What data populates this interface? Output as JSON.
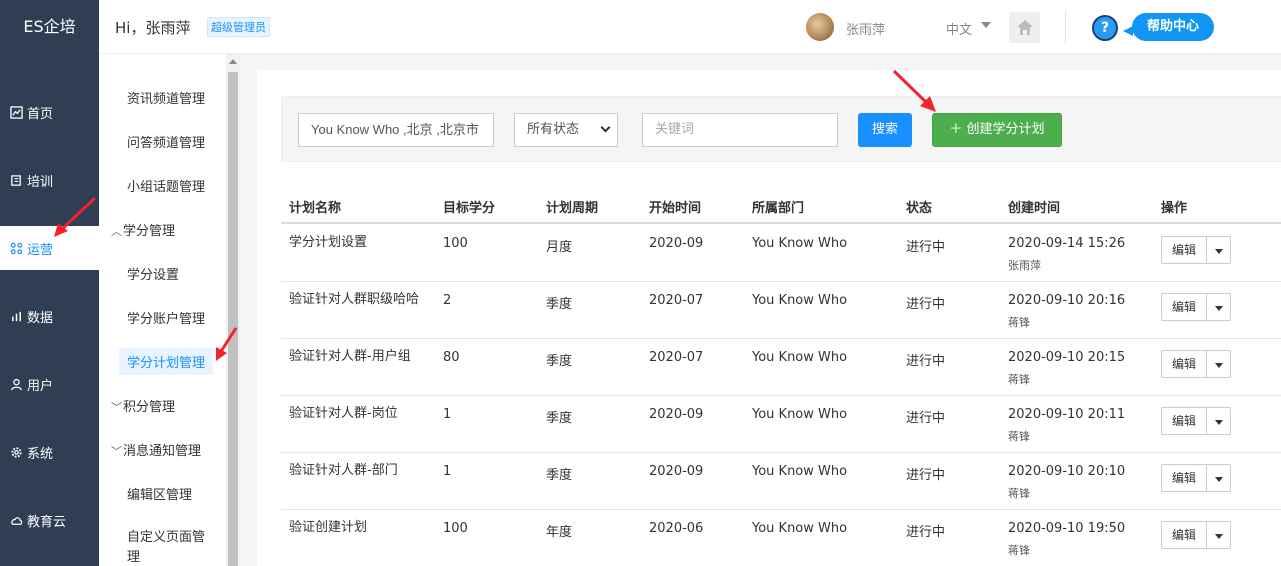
{
  "logo": "ES企培",
  "header": {
    "greeting": "Hi，张雨萍",
    "role": "超级管理员",
    "user_name": "张雨萍",
    "language": "中文",
    "help_center": "帮助中心",
    "help_mark": "?"
  },
  "leftnav": [
    {
      "label": "首页",
      "icon": "dashboard-icon"
    },
    {
      "label": "培训",
      "icon": "book-icon"
    },
    {
      "label": "运营",
      "icon": "operation-icon",
      "active": true
    },
    {
      "label": "数据",
      "icon": "chart-icon"
    },
    {
      "label": "用户",
      "icon": "user-icon"
    },
    {
      "label": "系统",
      "icon": "gear-icon"
    },
    {
      "label": "教育云",
      "icon": "cloud-icon"
    }
  ],
  "subnav": {
    "items": [
      "资讯频道管理",
      "问答频道管理",
      "小组话题管理"
    ],
    "group_credit": "学分管理",
    "credit_children": [
      "学分设置",
      "学分账户管理",
      "学分计划管理"
    ],
    "group_points": "积分管理",
    "group_notice": "消息通知管理",
    "more": [
      "编辑区管理",
      "自定义页面管理"
    ]
  },
  "filter": {
    "dept_value": "You Know Who ,北京 ,北京市",
    "status_selected": "所有状态",
    "keyword_placeholder": "关键词",
    "search_label": "搜索",
    "create_label": "＋ 创建学分计划"
  },
  "table": {
    "headers": [
      "计划名称",
      "目标学分",
      "计划周期",
      "开始时间",
      "所属部门",
      "状态",
      "创建时间",
      "操作"
    ],
    "edit_label": "编辑",
    "rows": [
      {
        "name": "学分计划设置",
        "target": "100",
        "cycle": "月度",
        "start": "2020-09",
        "dept": "You Know Who",
        "status": "进行中",
        "created": "2020-09-14 15:26",
        "creator": "张雨萍"
      },
      {
        "name": "验证针对人群职级哈哈",
        "target": "2",
        "cycle": "季度",
        "start": "2020-07",
        "dept": "You Know Who",
        "status": "进行中",
        "created": "2020-09-10 20:16",
        "creator": "蒋锋"
      },
      {
        "name": "验证针对人群-用户组",
        "target": "80",
        "cycle": "季度",
        "start": "2020-07",
        "dept": "You Know Who",
        "status": "进行中",
        "created": "2020-09-10 20:15",
        "creator": "蒋锋"
      },
      {
        "name": "验证针对人群-岗位",
        "target": "1",
        "cycle": "季度",
        "start": "2020-09",
        "dept": "You Know Who",
        "status": "进行中",
        "created": "2020-09-10 20:11",
        "creator": "蒋锋"
      },
      {
        "name": "验证针对人群-部门",
        "target": "1",
        "cycle": "季度",
        "start": "2020-09",
        "dept": "You Know Who",
        "status": "进行中",
        "created": "2020-09-10 20:10",
        "creator": "蒋锋"
      },
      {
        "name": "验证创建计划",
        "target": "100",
        "cycle": "年度",
        "start": "2020-06",
        "dept": "You Know Who",
        "status": "进行中",
        "created": "2020-09-10 19:50",
        "creator": "蒋锋"
      }
    ]
  },
  "colors": {
    "primary": "#1890ff",
    "success": "#4cae4c",
    "nav_bg": "#2f3e52",
    "arrow": "#f5222d"
  }
}
